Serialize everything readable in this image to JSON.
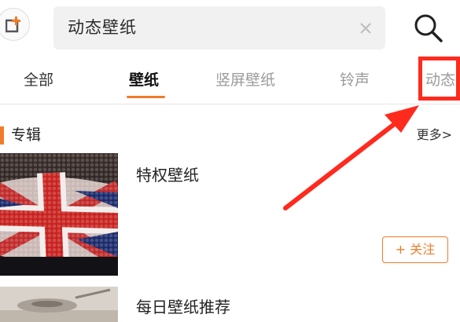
{
  "search": {
    "query": "动态壁纸"
  },
  "tabs": [
    {
      "label": "全部"
    },
    {
      "label": "壁纸"
    },
    {
      "label": "竖屏壁纸"
    },
    {
      "label": "铃声"
    },
    {
      "label": "动态"
    }
  ],
  "section": {
    "title": "专辑",
    "more_label": "更多>"
  },
  "albums": [
    {
      "title": "特权壁纸",
      "follow_label": "+ 关注"
    },
    {
      "title": "每日壁纸推荐"
    }
  ],
  "colors": {
    "accent": "#f07c2a",
    "annotation": "#ff2a1e"
  },
  "icons": {
    "app": "app-logo-icon",
    "clear": "clear-icon",
    "search": "search-icon"
  }
}
